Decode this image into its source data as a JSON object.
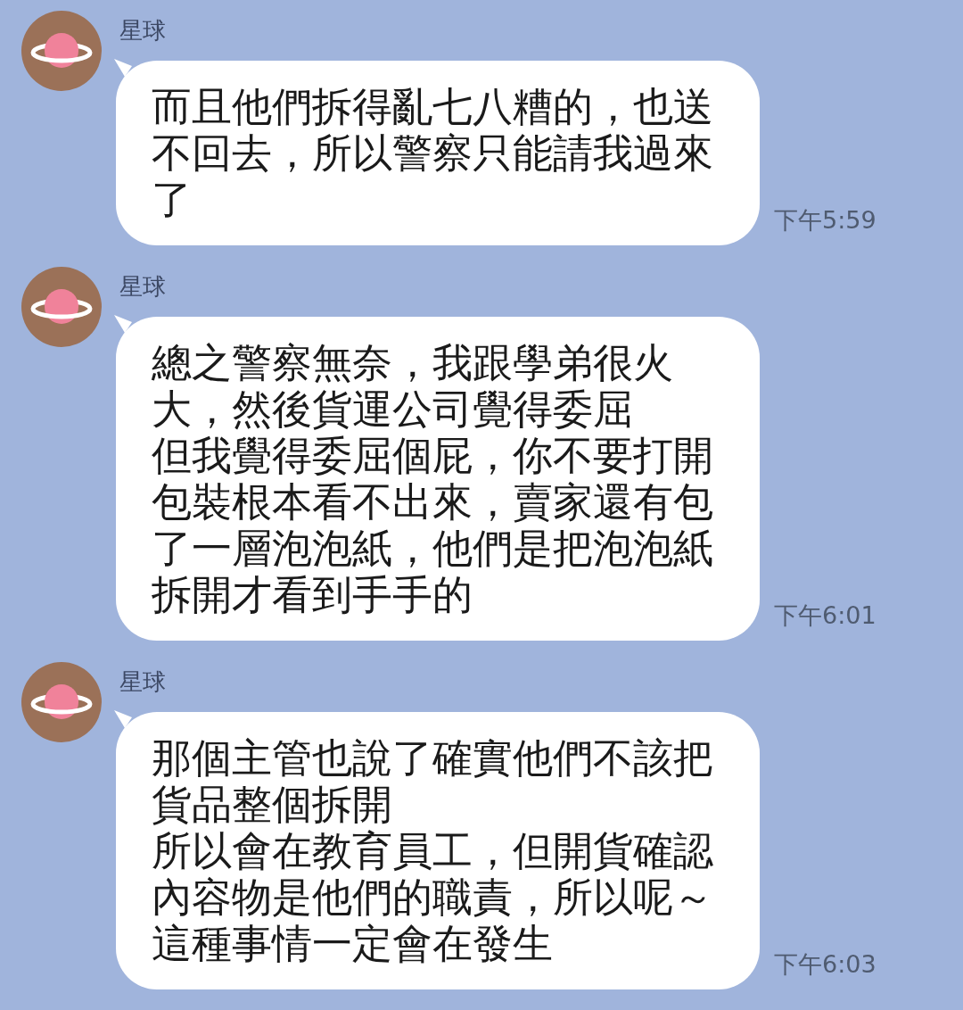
{
  "messages": [
    {
      "sender": "星球",
      "paragraphs": [
        "而且他們拆得亂七八糟的，也送不回去，所以警察只能請我過來了"
      ],
      "time": "下午5:59"
    },
    {
      "sender": "星球",
      "paragraphs": [
        "總之警察無奈，我跟學弟很火大，然後貨運公司覺得委屈",
        "但我覺得委屈個屁，你不要打開包裝根本看不出來，賣家還有包了一層泡泡紙，他們是把泡泡紙拆開才看到手手的"
      ],
      "time": "下午6:01"
    },
    {
      "sender": "星球",
      "paragraphs": [
        "那個主管也說了確實他們不該把貨品整個拆開",
        "所以會在教育員工，但開貨確認內容物是他們的職責，所以呢～這種事情一定會在發生"
      ],
      "time": "下午6:03"
    }
  ]
}
